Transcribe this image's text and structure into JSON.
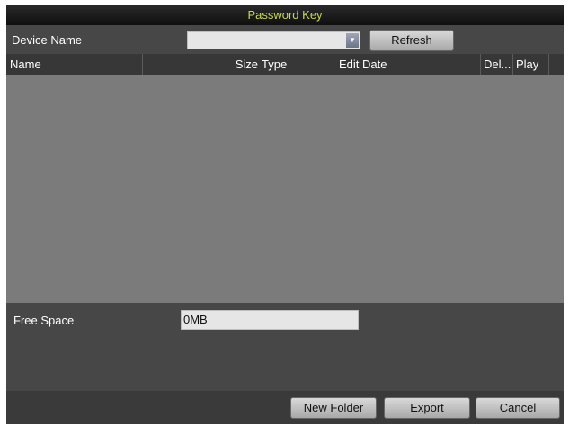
{
  "dialog": {
    "title": "Password Key"
  },
  "device": {
    "label": "Device Name",
    "selected_value": "",
    "refresh_label": "Refresh"
  },
  "table": {
    "columns": [
      "Name",
      "Size",
      "Type",
      "Edit Date",
      "Del...",
      "Play"
    ],
    "rows": []
  },
  "free_space": {
    "label": "Free Space",
    "value": "0MB"
  },
  "footer": {
    "new_folder_label": "New Folder",
    "export_label": "Export",
    "cancel_label": "Cancel"
  }
}
